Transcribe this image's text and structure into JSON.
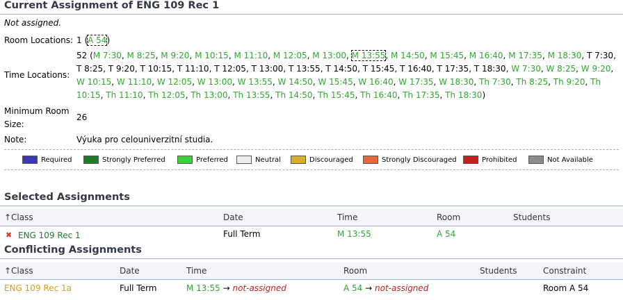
{
  "current": {
    "title": "Current Assignment of ENG 109 Rec 1",
    "status": "Not assigned.",
    "room_label": "Room Locations:",
    "room_count": "1 (",
    "room_value": "A 54",
    "room_close": ")",
    "time_label": "Time Locations:",
    "time_count": "52 (",
    "times": [
      {
        "t": "M 7:30",
        "c": "g"
      },
      {
        "t": "M 8:25",
        "c": "g"
      },
      {
        "t": "M 9:20",
        "c": "g"
      },
      {
        "t": "M 10:15",
        "c": "g"
      },
      {
        "t": "M 11:10",
        "c": "g"
      },
      {
        "t": "M 12:05",
        "c": "g"
      },
      {
        "t": "M 13:00",
        "c": "g"
      },
      {
        "t": "M 13:55",
        "c": "g",
        "boxed": true
      },
      {
        "t": "M 14:50",
        "c": "g"
      },
      {
        "t": "M 15:45",
        "c": "g"
      },
      {
        "t": "M 16:40",
        "c": "g"
      },
      {
        "t": "M 17:35",
        "c": "g"
      },
      {
        "t": "M 18:30",
        "c": "g"
      },
      {
        "t": "T 7:30",
        "c": "k"
      },
      {
        "t": "T 8:25",
        "c": "k"
      },
      {
        "t": "T 9:20",
        "c": "k"
      },
      {
        "t": "T 10:15",
        "c": "k"
      },
      {
        "t": "T 11:10",
        "c": "k"
      },
      {
        "t": "T 12:05",
        "c": "k"
      },
      {
        "t": "T 13:00",
        "c": "k"
      },
      {
        "t": "T 13:55",
        "c": "k"
      },
      {
        "t": "T 14:50",
        "c": "k"
      },
      {
        "t": "T 15:45",
        "c": "k"
      },
      {
        "t": "T 16:40",
        "c": "k"
      },
      {
        "t": "T 17:35",
        "c": "k"
      },
      {
        "t": "T 18:30",
        "c": "k"
      },
      {
        "t": "W 7:30",
        "c": "g"
      },
      {
        "t": "W 8:25",
        "c": "g"
      },
      {
        "t": "W 9:20",
        "c": "g"
      },
      {
        "t": "W 10:15",
        "c": "g"
      },
      {
        "t": "W 11:10",
        "c": "g"
      },
      {
        "t": "W 12:05",
        "c": "g"
      },
      {
        "t": "W 13:00",
        "c": "g"
      },
      {
        "t": "W 13:55",
        "c": "g"
      },
      {
        "t": "W 14:50",
        "c": "g"
      },
      {
        "t": "W 15:45",
        "c": "g"
      },
      {
        "t": "W 16:40",
        "c": "g"
      },
      {
        "t": "W 17:35",
        "c": "g"
      },
      {
        "t": "W 18:30",
        "c": "g"
      },
      {
        "t": "Th 7:30",
        "c": "g"
      },
      {
        "t": "Th 8:25",
        "c": "g"
      },
      {
        "t": "Th 9:20",
        "c": "g"
      },
      {
        "t": "Th 10:15",
        "c": "g"
      },
      {
        "t": "Th 11:10",
        "c": "g"
      },
      {
        "t": "Th 12:05",
        "c": "g"
      },
      {
        "t": "Th 13:00",
        "c": "g"
      },
      {
        "t": "Th 13:55",
        "c": "g"
      },
      {
        "t": "Th 14:50",
        "c": "g"
      },
      {
        "t": "Th 15:45",
        "c": "g"
      },
      {
        "t": "Th 16:40",
        "c": "g"
      },
      {
        "t": "Th 17:35",
        "c": "g"
      },
      {
        "t": "Th 18:30",
        "c": "g"
      }
    ],
    "time_close": ")",
    "min_label_1": "Minimum Room",
    "min_label_2": "Size:",
    "min_value": "26",
    "note_label": "Note:",
    "note_value": "Výuka pro celouniverzitní studia."
  },
  "legend": [
    {
      "label": "Required",
      "color": "#3a3ab4"
    },
    {
      "label": "Strongly Preferred",
      "color": "#1f7a2b"
    },
    {
      "label": "Preferred",
      "color": "#3ccf3c"
    },
    {
      "label": "Neutral",
      "color": "#efefef"
    },
    {
      "label": "Discouraged",
      "color": "#d4ae2c"
    },
    {
      "label": "Strongly Discouraged",
      "color": "#e8683c"
    },
    {
      "label": "Prohibited",
      "color": "#c81e1e"
    },
    {
      "label": "Not Available",
      "color": "#8c8c8c"
    }
  ],
  "selected": {
    "title": "Selected Assignments",
    "headers": {
      "class": "↑Class",
      "date": "Date",
      "time": "Time",
      "room": "Room",
      "students": "Students"
    },
    "row": {
      "remove": "✖",
      "class": "ENG 109 Rec 1",
      "date": "Full Term",
      "time": "M 13:55",
      "room": "A 54"
    }
  },
  "conflicting": {
    "title": "Conflicting Assignments",
    "headers": {
      "class": "↑Class",
      "date": "Date",
      "time": "Time",
      "room": "Room",
      "students": "Students",
      "constraint": "Constraint"
    },
    "row": {
      "class": "ENG 109 Rec 1a",
      "date": "Full Term",
      "time": "M 13:55",
      "arrow": "→",
      "not_assigned": "not-assigned",
      "room": "A 54",
      "constraint": "Room A 54"
    }
  }
}
